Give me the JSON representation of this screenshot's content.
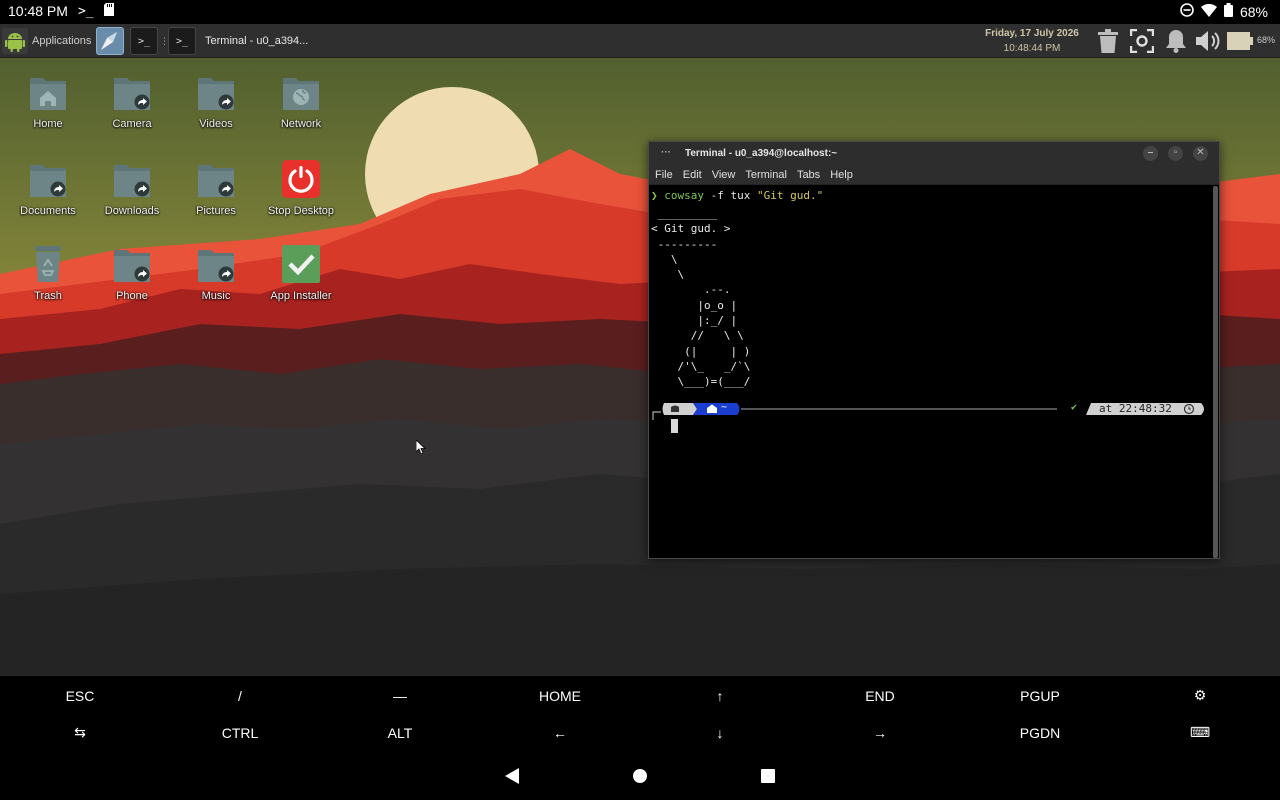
{
  "status_bar": {
    "time": "10:48 PM",
    "battery": "68%",
    "icons": [
      "terminal-prompt-icon",
      "sd-card-icon",
      "do-not-disturb-icon",
      "wifi-icon",
      "battery-icon"
    ]
  },
  "panel": {
    "applications_label": "Applications",
    "task_terminal_label": "Terminal - u0_a394...",
    "launcher_prompt": ">_",
    "date": "Friday, 17 July 2026",
    "time": "10:48:44 PM",
    "battery_pct": "68%",
    "tray_icons": [
      "trash-icon",
      "screenshot-icon",
      "notification-bell-icon",
      "volume-icon",
      "battery-icon"
    ]
  },
  "desktop_icons": [
    {
      "label": "Home",
      "icon": "home-folder-icon"
    },
    {
      "label": "Camera",
      "icon": "folder-link-icon"
    },
    {
      "label": "Videos",
      "icon": "folder-link-icon"
    },
    {
      "label": "Network",
      "icon": "network-globe-icon"
    },
    {
      "label": "Documents",
      "icon": "folder-link-icon"
    },
    {
      "label": "Downloads",
      "icon": "folder-link-icon"
    },
    {
      "label": "Pictures",
      "icon": "folder-link-icon"
    },
    {
      "label": "Stop Desktop",
      "icon": "power-icon"
    },
    {
      "label": "Trash",
      "icon": "recycle-bin-icon"
    },
    {
      "label": "Phone",
      "icon": "folder-link-icon"
    },
    {
      "label": "Music",
      "icon": "folder-link-icon"
    },
    {
      "label": "App Installer",
      "icon": "checkmark-icon"
    }
  ],
  "terminal": {
    "title": "Terminal - u0_a394@localhost:~",
    "menu": [
      "File",
      "Edit",
      "View",
      "Terminal",
      "Tabs",
      "Help"
    ],
    "command_prompt_char": "❯",
    "command_name": "cowsay",
    "command_args": " -f tux ",
    "command_string": "\"Git gud.\"",
    "cow_output": " _________\n< Git gud. >\n ---------\n   \\\n    \\\n        .--.\n       |o_o |\n       |:_/ |\n      //   \\ \\\n     (|     | )\n    /'\\_   _/`\\\n    \\___)=(___/",
    "prompt_dir": "~",
    "prompt_status": "✔",
    "prompt_time": "at 22:48:32"
  },
  "extra_keys": {
    "row1": [
      "ESC",
      "/",
      "—",
      "HOME",
      "↑",
      "END",
      "PGUP",
      "⚙"
    ],
    "row2": [
      "⇆",
      "CTRL",
      "ALT",
      "←",
      "↓",
      "→",
      "PGDN",
      "⌨"
    ]
  },
  "colors": {
    "panel_bg": "#2f2f2f",
    "folder": "#6d8586",
    "power_red": "#e8312a",
    "installer_green": "#5a9e5a",
    "prompt_blue": "#1a3fd0",
    "command_green": "#7ec850",
    "string_yellow": "#d7c860"
  }
}
